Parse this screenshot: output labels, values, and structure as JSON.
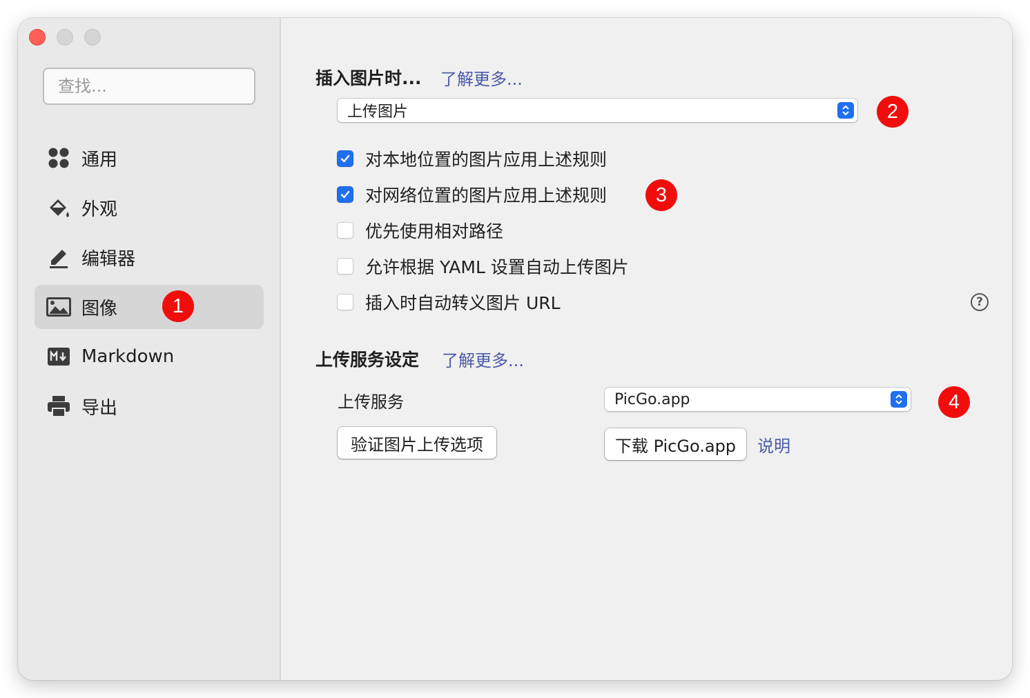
{
  "sidebar": {
    "search_placeholder": "查找...",
    "items": [
      {
        "label": "通用",
        "icon": "grid-icon"
      },
      {
        "label": "外观",
        "icon": "paint-bucket-icon"
      },
      {
        "label": "编辑器",
        "icon": "pencil-icon"
      },
      {
        "label": "图像",
        "icon": "image-icon",
        "active": true
      },
      {
        "label": "Markdown",
        "icon": "markdown-icon"
      },
      {
        "label": "导出",
        "icon": "printer-icon"
      }
    ]
  },
  "badges": [
    "1",
    "2",
    "3",
    "4"
  ],
  "insert_section": {
    "title": "插入图片时...",
    "learn_more": "了解更多...",
    "select_value": "上传图片",
    "options": [
      {
        "label": "对本地位置的图片应用上述规则",
        "checked": true
      },
      {
        "label": "对网络位置的图片应用上述规则",
        "checked": true
      },
      {
        "label": "优先使用相对路径",
        "checked": false
      },
      {
        "label": "允许根据 YAML 设置自动上传图片",
        "checked": false
      },
      {
        "label": "插入时自动转义图片 URL",
        "checked": false
      }
    ],
    "help_glyph": "?"
  },
  "upload_section": {
    "title": "上传服务设定",
    "learn_more": "了解更多...",
    "service_label": "上传服务",
    "service_value": "PicGo.app",
    "validate_button": "验证图片上传选项",
    "download_button": "下载 PicGo.app",
    "explain_link": "说明"
  },
  "colors": {
    "accent": "#1f6fef",
    "link": "#4a5aa8",
    "badge": "#f20d0d",
    "close": "#fe5f57"
  }
}
